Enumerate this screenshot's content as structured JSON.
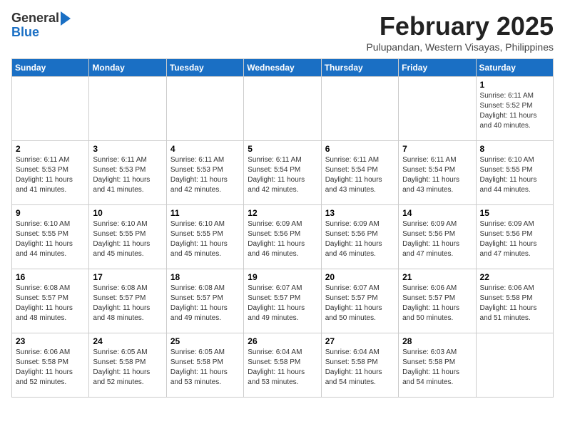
{
  "header": {
    "logo_line1": "General",
    "logo_line2": "Blue",
    "month": "February 2025",
    "location": "Pulupandan, Western Visayas, Philippines"
  },
  "weekdays": [
    "Sunday",
    "Monday",
    "Tuesday",
    "Wednesday",
    "Thursday",
    "Friday",
    "Saturday"
  ],
  "weeks": [
    [
      {
        "day": "",
        "info": ""
      },
      {
        "day": "",
        "info": ""
      },
      {
        "day": "",
        "info": ""
      },
      {
        "day": "",
        "info": ""
      },
      {
        "day": "",
        "info": ""
      },
      {
        "day": "",
        "info": ""
      },
      {
        "day": "1",
        "info": "Sunrise: 6:11 AM\nSunset: 5:52 PM\nDaylight: 11 hours\nand 40 minutes."
      }
    ],
    [
      {
        "day": "2",
        "info": "Sunrise: 6:11 AM\nSunset: 5:53 PM\nDaylight: 11 hours\nand 41 minutes."
      },
      {
        "day": "3",
        "info": "Sunrise: 6:11 AM\nSunset: 5:53 PM\nDaylight: 11 hours\nand 41 minutes."
      },
      {
        "day": "4",
        "info": "Sunrise: 6:11 AM\nSunset: 5:53 PM\nDaylight: 11 hours\nand 42 minutes."
      },
      {
        "day": "5",
        "info": "Sunrise: 6:11 AM\nSunset: 5:54 PM\nDaylight: 11 hours\nand 42 minutes."
      },
      {
        "day": "6",
        "info": "Sunrise: 6:11 AM\nSunset: 5:54 PM\nDaylight: 11 hours\nand 43 minutes."
      },
      {
        "day": "7",
        "info": "Sunrise: 6:11 AM\nSunset: 5:54 PM\nDaylight: 11 hours\nand 43 minutes."
      },
      {
        "day": "8",
        "info": "Sunrise: 6:10 AM\nSunset: 5:55 PM\nDaylight: 11 hours\nand 44 minutes."
      }
    ],
    [
      {
        "day": "9",
        "info": "Sunrise: 6:10 AM\nSunset: 5:55 PM\nDaylight: 11 hours\nand 44 minutes."
      },
      {
        "day": "10",
        "info": "Sunrise: 6:10 AM\nSunset: 5:55 PM\nDaylight: 11 hours\nand 45 minutes."
      },
      {
        "day": "11",
        "info": "Sunrise: 6:10 AM\nSunset: 5:55 PM\nDaylight: 11 hours\nand 45 minutes."
      },
      {
        "day": "12",
        "info": "Sunrise: 6:09 AM\nSunset: 5:56 PM\nDaylight: 11 hours\nand 46 minutes."
      },
      {
        "day": "13",
        "info": "Sunrise: 6:09 AM\nSunset: 5:56 PM\nDaylight: 11 hours\nand 46 minutes."
      },
      {
        "day": "14",
        "info": "Sunrise: 6:09 AM\nSunset: 5:56 PM\nDaylight: 11 hours\nand 47 minutes."
      },
      {
        "day": "15",
        "info": "Sunrise: 6:09 AM\nSunset: 5:56 PM\nDaylight: 11 hours\nand 47 minutes."
      }
    ],
    [
      {
        "day": "16",
        "info": "Sunrise: 6:08 AM\nSunset: 5:57 PM\nDaylight: 11 hours\nand 48 minutes."
      },
      {
        "day": "17",
        "info": "Sunrise: 6:08 AM\nSunset: 5:57 PM\nDaylight: 11 hours\nand 48 minutes."
      },
      {
        "day": "18",
        "info": "Sunrise: 6:08 AM\nSunset: 5:57 PM\nDaylight: 11 hours\nand 49 minutes."
      },
      {
        "day": "19",
        "info": "Sunrise: 6:07 AM\nSunset: 5:57 PM\nDaylight: 11 hours\nand 49 minutes."
      },
      {
        "day": "20",
        "info": "Sunrise: 6:07 AM\nSunset: 5:57 PM\nDaylight: 11 hours\nand 50 minutes."
      },
      {
        "day": "21",
        "info": "Sunrise: 6:06 AM\nSunset: 5:57 PM\nDaylight: 11 hours\nand 50 minutes."
      },
      {
        "day": "22",
        "info": "Sunrise: 6:06 AM\nSunset: 5:58 PM\nDaylight: 11 hours\nand 51 minutes."
      }
    ],
    [
      {
        "day": "23",
        "info": "Sunrise: 6:06 AM\nSunset: 5:58 PM\nDaylight: 11 hours\nand 52 minutes."
      },
      {
        "day": "24",
        "info": "Sunrise: 6:05 AM\nSunset: 5:58 PM\nDaylight: 11 hours\nand 52 minutes."
      },
      {
        "day": "25",
        "info": "Sunrise: 6:05 AM\nSunset: 5:58 PM\nDaylight: 11 hours\nand 53 minutes."
      },
      {
        "day": "26",
        "info": "Sunrise: 6:04 AM\nSunset: 5:58 PM\nDaylight: 11 hours\nand 53 minutes."
      },
      {
        "day": "27",
        "info": "Sunrise: 6:04 AM\nSunset: 5:58 PM\nDaylight: 11 hours\nand 54 minutes."
      },
      {
        "day": "28",
        "info": "Sunrise: 6:03 AM\nSunset: 5:58 PM\nDaylight: 11 hours\nand 54 minutes."
      },
      {
        "day": "",
        "info": ""
      }
    ]
  ]
}
